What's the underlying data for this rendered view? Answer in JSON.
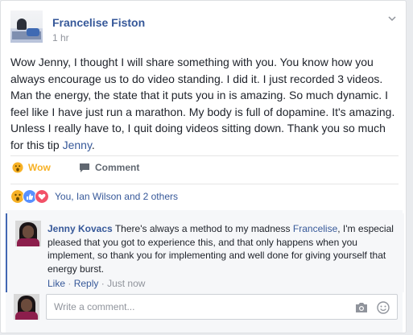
{
  "post": {
    "author": "Francelise Fiston",
    "time": "1 hr",
    "text_before_mention": "Wow Jenny, I thought I will share something with you. You know how you always encourage us to do video standing. I did it. I just recorded 3 videos. Man the energy, the state that it puts you in is amazing. So much dynamic. I feel like I have just run a marathon. My body is full of dopamine. It's amazing. Unless I really have to, I quit doing videos sitting down. Thank you so much for this tip ",
    "mention": "Jenny",
    "text_after_mention": "."
  },
  "actions": {
    "wow_label": "Wow",
    "comment_label": "Comment"
  },
  "reactions": {
    "summary": "You, Ian Wilson and 2 others",
    "icons": [
      "wow-icon",
      "like-icon",
      "love-icon"
    ]
  },
  "comment": {
    "author": "Jenny Kovacs",
    "text_before_mention": "There's always a method to my madness ",
    "mention": "Francelise",
    "text_after_mention": ", I'm especial pleased that you got to experience this, and that only happens when you implement, so thank you for implementing and well done for giving yourself that energy burst.",
    "like_label": "Like",
    "reply_label": "Reply",
    "separator": "·",
    "time": "Just now"
  },
  "composer": {
    "placeholder": "Write a comment..."
  },
  "colors": {
    "link_blue": "#365899",
    "wow_yellow": "#f7b125",
    "meta_gray": "#90949c"
  }
}
